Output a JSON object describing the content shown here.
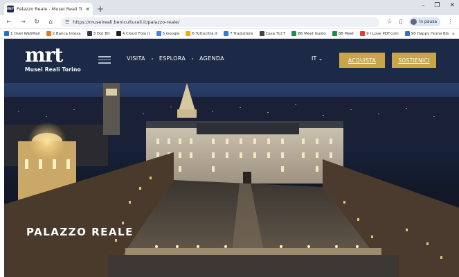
{
  "browser": {
    "tab_title": "Palazzo Reale - Musei Reali Tori",
    "tab_favicon": "mrt",
    "new_tab": "+",
    "url": "https://museireali.beniculturali.it/palazzo-reale/",
    "profile_label": "In pausa",
    "icons": [
      "back-icon",
      "forward-icon",
      "reload-icon",
      "home-icon",
      "site-info-icon",
      "star-icon",
      "sidepanel-icon",
      "menu-icon"
    ]
  },
  "bookmarks": [
    {
      "label": "1 Ovel WebMail",
      "color": "#1f6fd6"
    },
    {
      "label": "2 Banca Intesa",
      "color": "#e07b1f"
    },
    {
      "label": "3 Dot Bit",
      "color": "#2f3a4a"
    },
    {
      "label": "4 Cloud Foto.it",
      "color": "#222222"
    },
    {
      "label": "5 Google",
      "color": "#4285f4"
    },
    {
      "label": "6 Tuttocittà.it",
      "color": "#f2b100"
    },
    {
      "label": "7 Traduttore",
      "color": "#2a7de1"
    },
    {
      "label": "Casa TLCT",
      "color": "#444444"
    },
    {
      "label": "86 Meet Guido",
      "color": "#1a8f4a"
    },
    {
      "label": "88 Meet",
      "color": "#1a8f4a"
    },
    {
      "label": "9 I Love PDF.com",
      "color": "#e23b3b"
    },
    {
      "label": "90 Happy Home BG",
      "color": "#3b6bd6"
    }
  ],
  "site": {
    "logo_mark": "mrt",
    "logo_name": "Musei Reali Torino",
    "nav": [
      "VISITA",
      "ESPLORA",
      "AGENDA"
    ],
    "lang": "IT",
    "acquista": "ACQUISTA",
    "sostienici": "SOSTIENICI",
    "gold": "#c8a44a",
    "navy": "#1c2a47"
  },
  "hero": {
    "title": "PALAZZO REALE"
  }
}
